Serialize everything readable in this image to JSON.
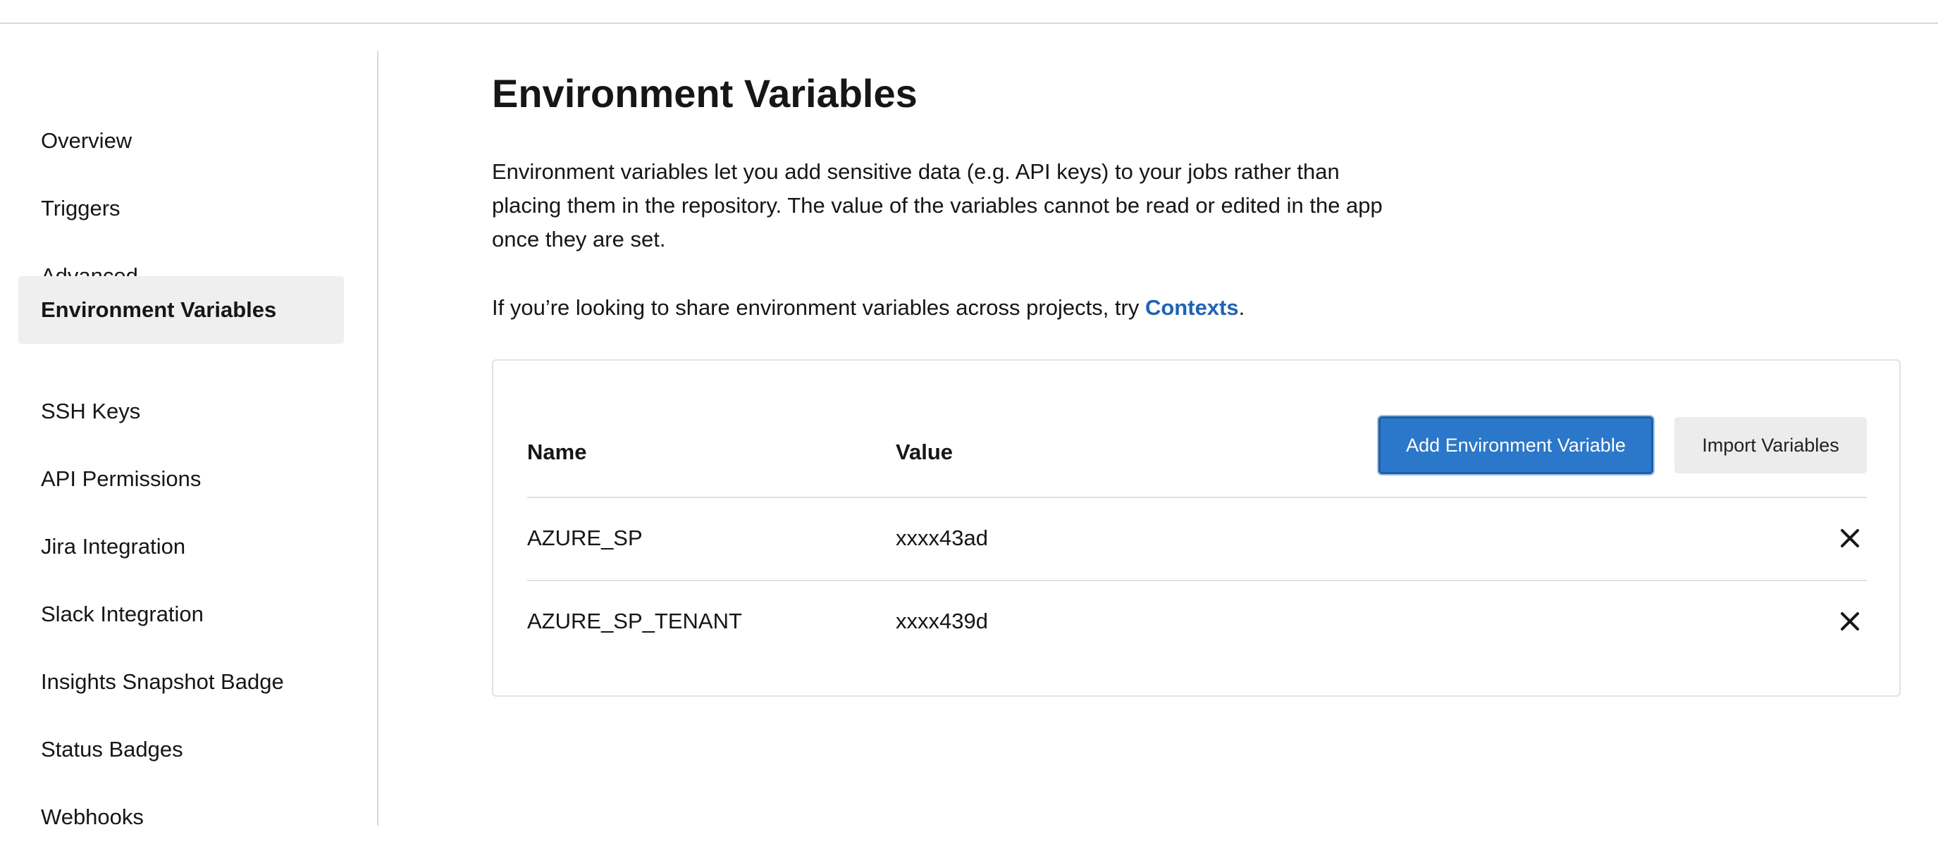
{
  "sidebar": {
    "items": [
      {
        "label": "Overview"
      },
      {
        "label": "Triggers"
      },
      {
        "label": "Advanced"
      },
      {
        "label": "Environment Variables",
        "active": true
      },
      {
        "label": "SSH Keys"
      },
      {
        "label": "API Permissions"
      },
      {
        "label": "Jira Integration"
      },
      {
        "label": "Slack Integration"
      },
      {
        "label": "Insights Snapshot Badge"
      },
      {
        "label": "Status Badges"
      },
      {
        "label": "Webhooks"
      }
    ]
  },
  "main": {
    "title": "Environment Variables",
    "description": "Environment variables let you add sensitive data (e.g. API keys) to your jobs rather than placing them in the repository. The value of the variables cannot be read or edited in the app once they are set.",
    "share_text": "If you’re looking to share environment variables across projects, try ",
    "share_link": "Contexts",
    "share_suffix": "."
  },
  "table": {
    "headers": {
      "name": "Name",
      "value": "Value"
    },
    "add_button": "Add Environment Variable",
    "import_button": "Import Variables",
    "rows": [
      {
        "name": "AZURE_SP",
        "value": "xxxx43ad"
      },
      {
        "name": "AZURE_SP_TENANT",
        "value": "xxxx439d"
      }
    ]
  },
  "colors": {
    "accent": "#2b77c9",
    "link": "#1f63b4",
    "active_nav_bg": "#efefef"
  },
  "icons": {
    "delete": "close-icon"
  }
}
